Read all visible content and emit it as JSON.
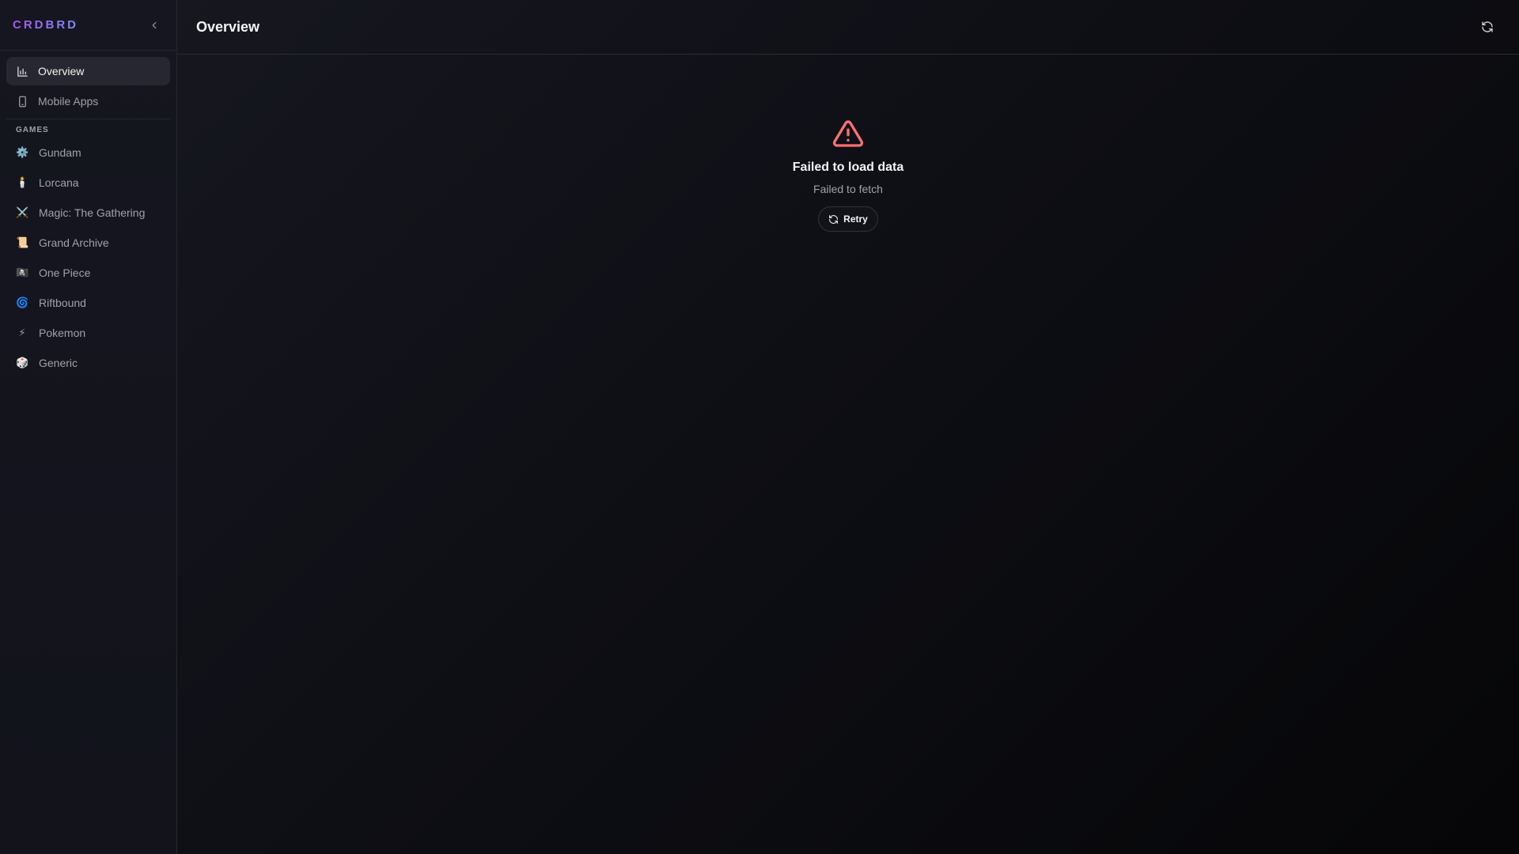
{
  "sidebar": {
    "brand": "CRDBRD",
    "nav": [
      {
        "label": "Overview",
        "icon": "bar-chart-icon",
        "active": true
      },
      {
        "label": "Mobile Apps",
        "icon": "smartphone-icon",
        "active": false
      }
    ],
    "games_section_label": "GAMES",
    "games": [
      {
        "label": "Gundam",
        "icon": "⚙️"
      },
      {
        "label": "Lorcana",
        "icon": "🕯️"
      },
      {
        "label": "Magic: The Gathering",
        "icon": "⚔️"
      },
      {
        "label": "Grand Archive",
        "icon": "📜"
      },
      {
        "label": "One Piece",
        "icon": "🏴‍☠️"
      },
      {
        "label": "Riftbound",
        "icon": "🌀"
      },
      {
        "label": "Pokemon",
        "icon": "⚡"
      },
      {
        "label": "Generic",
        "icon": "🎲"
      }
    ]
  },
  "header": {
    "title": "Overview"
  },
  "error": {
    "title": "Failed to load data",
    "message": "Failed to fetch",
    "retry_label": "Retry"
  },
  "colors": {
    "brand_start": "#a855f7",
    "brand_end": "#818cf8",
    "error": "#f87171",
    "active_bg": "#262730"
  }
}
